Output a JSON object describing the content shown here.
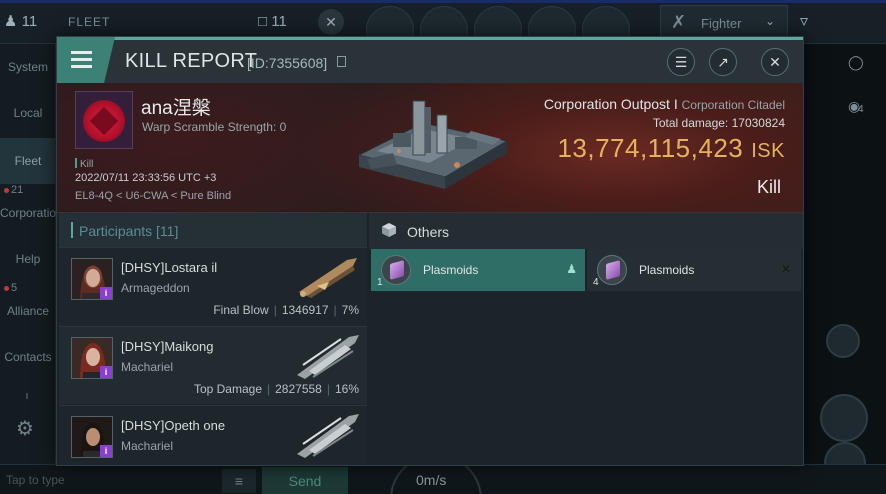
{
  "background": {
    "pilot_count": "11",
    "fleet_label": "FLEET",
    "fleet_count": "11",
    "fighter_label": "Fighter",
    "sidebar": [
      {
        "label": "System"
      },
      {
        "label": "Local"
      },
      {
        "label": "Fleet"
      },
      {
        "label": "Corporation",
        "badge": "21"
      },
      {
        "label": "Help"
      },
      {
        "label": "Alliance",
        "badge": "5"
      },
      {
        "label": "Contacts"
      }
    ],
    "right_counter": "4",
    "chat_placeholder": "Tap to type",
    "send_label": "Send",
    "speed": "0m/s"
  },
  "modal": {
    "title": "KILL REPORT",
    "report_id": "[ID:7355608]"
  },
  "victim": {
    "name": "ana涅槃",
    "subtitle": "Warp Scramble Strength: 0",
    "tag": "Kill",
    "datetime": "2022/07/11 23:33:56 UTC +3",
    "location": "EL8-4Q < U6-CWA < Pure Blind",
    "target_name": "Corporation Outpost I",
    "target_class": "Corporation Citadel",
    "damage_label": "Total damage:",
    "damage_value": "17030824",
    "isk_value": "13,774,115,423",
    "isk_unit": "ISK",
    "result": "Kill"
  },
  "participants": {
    "header": "Participants [11]",
    "rows": [
      {
        "name": "[DHSY]Lostara il",
        "ship": "Armageddon",
        "stat_label": "Final Blow",
        "damage": "1346917",
        "percent": "7%"
      },
      {
        "name": "[DHSY]Maikong",
        "ship": "Machariel",
        "stat_label": "Top Damage",
        "damage": "2827558",
        "percent": "16%"
      },
      {
        "name": "[DHSY]Opeth one",
        "ship": "Machariel",
        "stat_label": "",
        "damage": "",
        "percent": ""
      }
    ]
  },
  "others": {
    "header": "Others",
    "items": [
      {
        "qty": "1",
        "name": "Plasmoids",
        "selected": true
      },
      {
        "qty": "4",
        "name": "Plasmoids",
        "selected": false
      }
    ]
  },
  "colors": {
    "accent": "#5aa99d",
    "isk": "#e7b25d",
    "selected_item": "#2f6e66"
  }
}
